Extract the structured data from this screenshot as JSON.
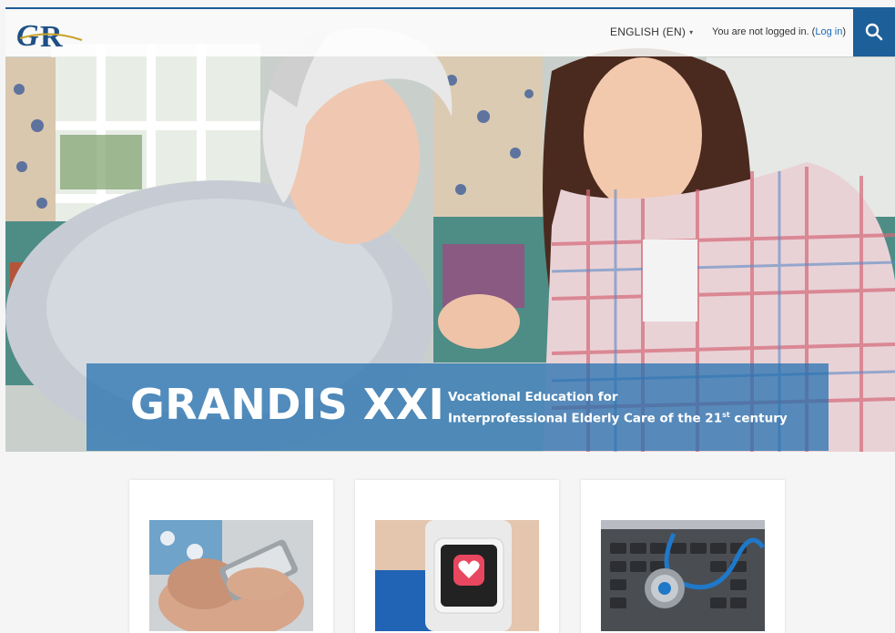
{
  "header": {
    "logo_text": "GR",
    "language": {
      "label": "ENGLISH (EN)",
      "caret": "▾"
    },
    "login": {
      "prefix": "You are not logged in. (",
      "link": "Log in",
      "suffix": ")"
    },
    "search_icon": "search-icon"
  },
  "hero": {
    "image": "photo-elderly-woman-and-young-woman-with-tablet",
    "banner": {
      "title": "GRANDIS XXI",
      "subtitle_line1": "Vocational Education for",
      "subtitle_line2_prefix": "Interprofessional Elderly Care of the 21",
      "subtitle_line2_sup": "st",
      "subtitle_line2_suffix": " century"
    }
  },
  "cards": [
    {
      "image": "photo-hands-holding-smartphone"
    },
    {
      "image": "photo-smartwatch-heart-app"
    },
    {
      "image": "photo-stethoscope-on-laptop-keyboard"
    }
  ],
  "colors": {
    "brand_blue": "#1d5f99",
    "banner_blue": "#1e6eaf",
    "link_blue": "#1a6bb8",
    "page_bg": "#f5f5f5"
  }
}
